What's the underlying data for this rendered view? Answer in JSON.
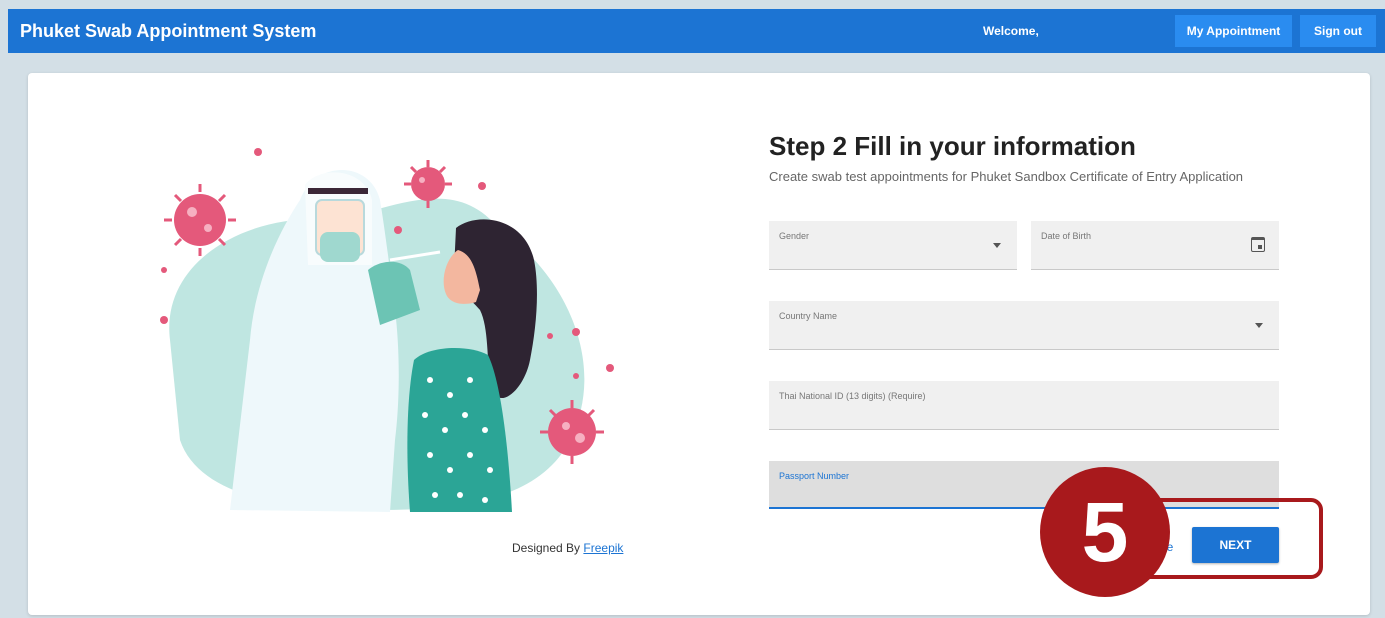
{
  "header": {
    "app_title": "Phuket Swab Appointment System",
    "welcome": "Welcome,",
    "my_appointment": "My Appointment",
    "sign_out": "Sign out"
  },
  "illustration": {
    "credit_prefix": "Designed By",
    "credit_link": "Freepik"
  },
  "form": {
    "step_title": "Step 2 Fill in your information",
    "subtitle": "Create swab test appointments for Phuket Sandbox Certificate of Entry Application",
    "gender_label": "Gender",
    "dob_label": "Date of Birth",
    "country_label": "Country Name",
    "thai_id_label": "Thai National ID (13 digits) (Require)",
    "passport_label": "Passport Number",
    "back_label": "ge",
    "next_label": "NEXT"
  },
  "callout": {
    "number": "5",
    "color": "#a8191c"
  },
  "colors": {
    "primary": "#1c74d3",
    "background": "#d3dfe6"
  }
}
